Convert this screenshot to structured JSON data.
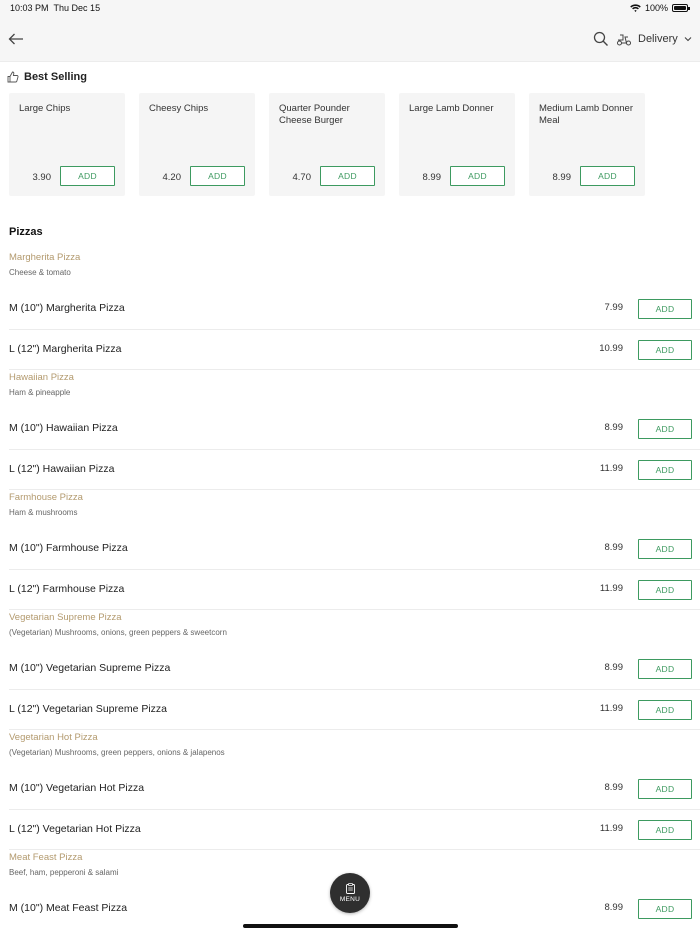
{
  "status_bar": {
    "time": "10:03 PM",
    "date": "Thu Dec 15",
    "battery": "100%"
  },
  "nav": {
    "delivery_label": "Delivery"
  },
  "best_selling": {
    "title": "Best Selling",
    "items": [
      {
        "name": "Large Chips",
        "price": "3.90",
        "add_label": "ADD"
      },
      {
        "name": "Cheesy Chips",
        "price": "4.20",
        "add_label": "ADD"
      },
      {
        "name": "Quarter Pounder Cheese Burger",
        "price": "4.70",
        "add_label": "ADD"
      },
      {
        "name": "Large Lamb Donner",
        "price": "8.99",
        "add_label": "ADD"
      },
      {
        "name": "Medium Lamb Donner Meal",
        "price": "8.99",
        "add_label": "ADD"
      }
    ]
  },
  "category": {
    "title": "Pizzas",
    "groups": [
      {
        "name": "Margherita Pizza",
        "description": "Cheese & tomato",
        "items": [
          {
            "name": "M (10\") Margherita Pizza",
            "price": "7.99",
            "add_label": "ADD"
          },
          {
            "name": "L (12\") Margherita Pizza",
            "price": "10.99",
            "add_label": "ADD"
          }
        ]
      },
      {
        "name": "Hawaiian Pizza",
        "description": "Ham & pineapple",
        "items": [
          {
            "name": "M (10\") Hawaiian Pizza",
            "price": "8.99",
            "add_label": "ADD"
          },
          {
            "name": "L (12\") Hawaiian Pizza",
            "price": "11.99",
            "add_label": "ADD"
          }
        ]
      },
      {
        "name": "Farmhouse Pizza",
        "description": "Ham & mushrooms",
        "items": [
          {
            "name": "M (10\") Farmhouse Pizza",
            "price": "8.99",
            "add_label": "ADD"
          },
          {
            "name": "L (12\") Farmhouse Pizza",
            "price": "11.99",
            "add_label": "ADD"
          }
        ]
      },
      {
        "name": "Vegetarian Supreme Pizza",
        "description": "(Vegetarian) Mushrooms, onions, green peppers & sweetcorn",
        "items": [
          {
            "name": "M (10\") Vegetarian Supreme Pizza",
            "price": "8.99",
            "add_label": "ADD"
          },
          {
            "name": "L (12\") Vegetarian Supreme Pizza",
            "price": "11.99",
            "add_label": "ADD"
          }
        ]
      },
      {
        "name": "Vegetarian Hot Pizza",
        "description": "(Vegetarian) Mushrooms, green peppers, onions & jalapenos",
        "items": [
          {
            "name": "M (10\") Vegetarian Hot Pizza",
            "price": "8.99",
            "add_label": "ADD"
          },
          {
            "name": "L (12\") Vegetarian Hot Pizza",
            "price": "11.99",
            "add_label": "ADD"
          }
        ]
      },
      {
        "name": "Meat Feast Pizza",
        "description": "Beef, ham, pepperoni & salami",
        "items": [
          {
            "name": "M (10\") Meat Feast Pizza",
            "price": "8.99",
            "add_label": "ADD"
          }
        ]
      }
    ]
  },
  "menu_button": {
    "label": "MENU"
  },
  "colors": {
    "accent_green": "#3d9a60",
    "group_name": "#b39a6e",
    "fab": "#2f2f2f"
  }
}
